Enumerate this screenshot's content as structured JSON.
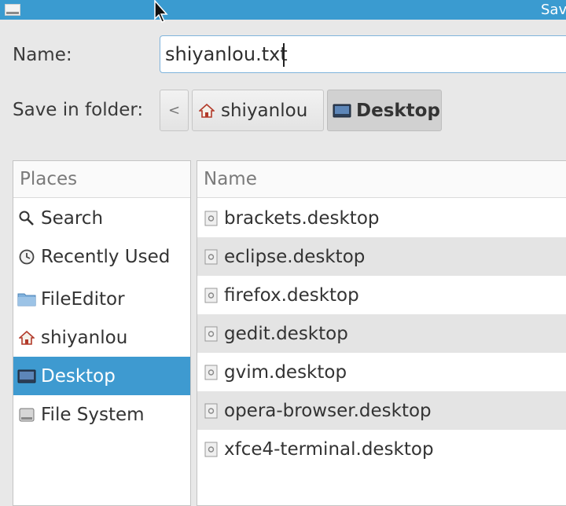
{
  "window": {
    "title": "Sav"
  },
  "name_row": {
    "label": "Name:",
    "value": "shiyanlou.txt"
  },
  "folder_row": {
    "label": "Save in folder:",
    "back_glyph": "<",
    "crumbs": [
      {
        "label": "shiyanlou",
        "icon": "home-icon"
      },
      {
        "label": "Desktop",
        "icon": "desktop-icon",
        "active": true
      }
    ]
  },
  "places": {
    "header": "Places",
    "items": [
      {
        "label": "Search",
        "icon": "search-icon"
      },
      {
        "label": "Recently Used",
        "icon": "clock-icon"
      },
      {
        "label": "FileEditor",
        "icon": "folder-icon"
      },
      {
        "label": "shiyanlou",
        "icon": "home-icon"
      },
      {
        "label": "Desktop",
        "icon": "desktop-icon",
        "selected": true
      },
      {
        "label": "File System",
        "icon": "drive-icon"
      }
    ]
  },
  "files": {
    "header": "Name",
    "items": [
      "brackets.desktop",
      "eclipse.desktop",
      "firefox.desktop",
      "gedit.desktop",
      "gvim.desktop",
      "opera-browser.desktop",
      "xfce4-terminal.desktop"
    ]
  },
  "colors": {
    "titlebar": "#3a9bd0",
    "selection": "#3e9ad0",
    "row_alt": "#e4e4e4"
  }
}
